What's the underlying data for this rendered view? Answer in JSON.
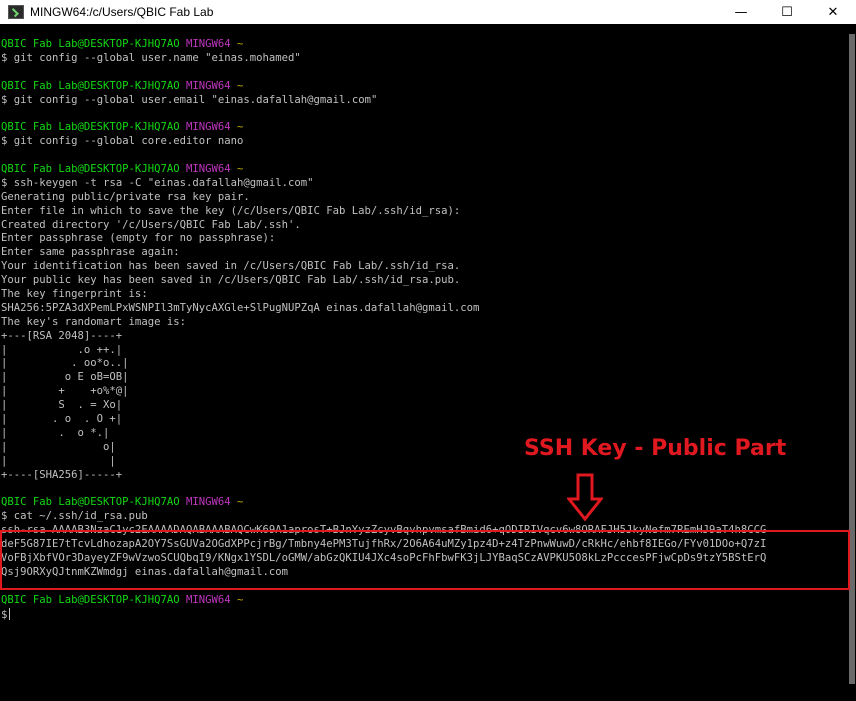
{
  "window": {
    "title": "MINGW64:/c/Users/QBIC Fab Lab",
    "icon": "mingw-terminal-icon",
    "controls": {
      "minimize": "—",
      "maximize": "☐",
      "close": "✕"
    }
  },
  "prompt": {
    "user_host": "QBIC Fab Lab@DESKTOP-KJHQ7AO",
    "shell": "MINGW64",
    "dir": "~",
    "symbol": "$"
  },
  "commands": {
    "c1": "git config --global user.name \"einas.mohamed\"",
    "c2": "git config --global user.email \"einas.dafallah@gmail.com\"",
    "c3": "git config --global core.editor nano",
    "c4": "ssh-keygen -t rsa -C \"einas.dafallah@gmail.com\"",
    "c5": "cat ~/.ssh/id_rsa.pub"
  },
  "keygen_output": [
    "Generating public/private rsa key pair.",
    "Enter file in which to save the key (/c/Users/QBIC Fab Lab/.ssh/id_rsa):",
    "Created directory '/c/Users/QBIC Fab Lab/.ssh'.",
    "Enter passphrase (empty for no passphrase):",
    "Enter same passphrase again:",
    "Your identification has been saved in /c/Users/QBIC Fab Lab/.ssh/id_rsa.",
    "Your public key has been saved in /c/Users/QBIC Fab Lab/.ssh/id_rsa.pub.",
    "The key fingerprint is:",
    "SHA256:5PZA3dXPemLPxWSNPIl3mTyNycAXGle+SlPugNUPZqA einas.dafallah@gmail.com",
    "The key's randomart image is:"
  ],
  "randomart": [
    "+---[RSA 2048]----+",
    "|           .o ++.|",
    "|          . oo*o..|",
    "|         o E oB=OB|",
    "|        +    +o%*@|",
    "|        S  . = Xo|",
    "|       . o  . O +|",
    "|        .  o *.|",
    "|               o|",
    "|                |",
    "+----[SHA256]-----+"
  ],
  "public_key": [
    "ssh-rsa AAAAB3NzaC1yc2EAAAADAQABAAABAQCwK69A1aprosT+BJnYyzZcyvBqvhpvmsafBmid6+qODIRIVqcv6w8ORAFJH5JkyNefm7REmHJ9aT4h8CCG",
    "deF5G87IE7tTcvLdhozapA2OY7SsGUVa2OGdXPPcjrBg/Tmbny4ePM3TujfhRx/2O6A64uMZy1pz4D+z4TzPnwWuwD/cRkHc/ehbf8IEGo/FYv01DOo+Q7zI",
    "VoFBjXbfVOr3DayeyZF9wVzwoSCUQbqI9/KNgx1YSDL/oGMW/abGzQKIU4JXc4soPcFhFbwFK3jLJYBaqSCzAVPKU5O8kLzPcccesPFjwCpDs9tzY5BStErQ",
    "Qsj9ORXyQJtnmKZWmdgj einas.dafallah@gmail.com"
  ],
  "annotation": {
    "label": "SSH Key - Public Part",
    "arrow": "down-arrow-icon",
    "color": "#e0181f"
  }
}
